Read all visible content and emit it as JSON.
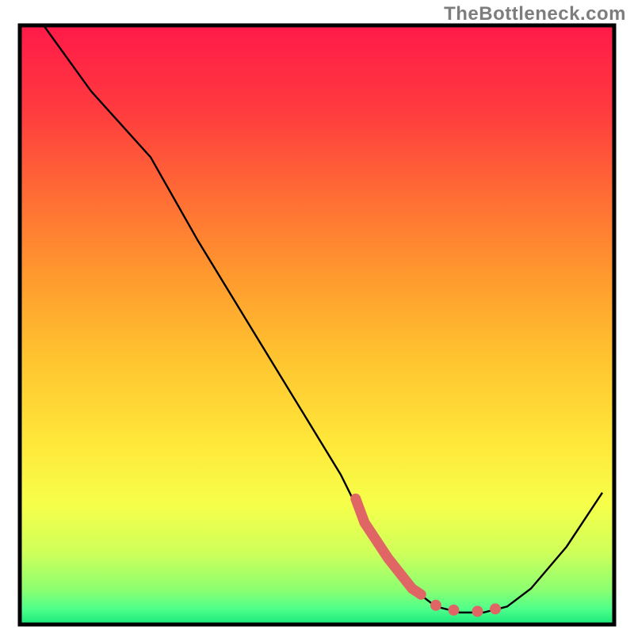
{
  "watermark": "TheBottleneck.com",
  "chart_data": {
    "type": "line",
    "title": "",
    "xlabel": "",
    "ylabel": "",
    "xlim": [
      0,
      100
    ],
    "ylim": [
      0,
      100
    ],
    "notes": "Background is a vertical red→yellow→green gradient framed in black. A single black curve descends from top-left, reaches a flat minimum near x≈70–82, then rises toward the right. A thick coral/pink overlay segment highlights the curve roughly from x≈57 to x≈68 plus a few dotted points near the trough.",
    "series": [
      {
        "name": "curve",
        "x": [
          4,
          12,
          22,
          30,
          38,
          46,
          54,
          58,
          62,
          66,
          70,
          74,
          78,
          82,
          86,
          92,
          98
        ],
        "y": [
          100,
          89,
          78,
          64,
          51,
          38,
          25,
          17,
          11,
          6,
          3,
          2,
          2,
          3,
          6,
          13,
          22
        ]
      }
    ],
    "highlight_segment": {
      "name": "pink-overlay",
      "x": [
        56.5,
        58,
        60,
        62,
        64,
        66,
        67.5
      ],
      "y": [
        21,
        17,
        14,
        11,
        8.5,
        6,
        5
      ]
    },
    "highlight_dots": {
      "name": "pink-dots",
      "points": [
        {
          "x": 70,
          "y": 3.2
        },
        {
          "x": 73,
          "y": 2.4
        },
        {
          "x": 77,
          "y": 2.2
        },
        {
          "x": 80,
          "y": 2.6
        }
      ]
    },
    "gradient_stops": [
      {
        "offset": 0.0,
        "color": "#ff1a49"
      },
      {
        "offset": 0.14,
        "color": "#ff3a3f"
      },
      {
        "offset": 0.28,
        "color": "#ff6b35"
      },
      {
        "offset": 0.42,
        "color": "#ff9a2e"
      },
      {
        "offset": 0.56,
        "color": "#ffc530"
      },
      {
        "offset": 0.7,
        "color": "#ffe83a"
      },
      {
        "offset": 0.8,
        "color": "#f6ff4a"
      },
      {
        "offset": 0.88,
        "color": "#cfff5a"
      },
      {
        "offset": 0.94,
        "color": "#8fff70"
      },
      {
        "offset": 0.975,
        "color": "#4dff8a"
      },
      {
        "offset": 1.0,
        "color": "#17e67a"
      }
    ],
    "frame": {
      "stroke": "#000000",
      "stroke_width": 5
    },
    "curve_style": {
      "stroke": "#000000",
      "stroke_width": 2.4
    },
    "highlight_style": {
      "stroke": "#e06666",
      "stroke_width": 13,
      "dot_r": 7
    }
  }
}
